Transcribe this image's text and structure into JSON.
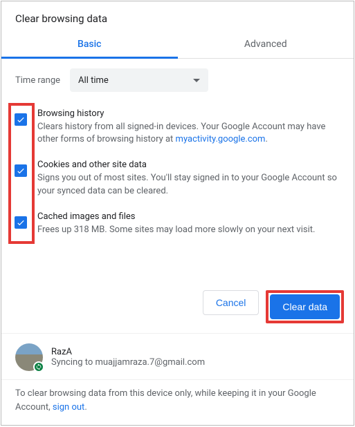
{
  "dialog": {
    "title": "Clear browsing data"
  },
  "tabs": {
    "basic": "Basic",
    "advanced": "Advanced"
  },
  "time_range": {
    "label": "Time range",
    "value": "All time"
  },
  "options": {
    "browsing": {
      "title": "Browsing history",
      "desc_pre": "Clears history from all signed-in devices. Your Google Account may have other forms of browsing history at ",
      "desc_link": "myactivity.google.com",
      "desc_post": ".",
      "checked": true
    },
    "cookies": {
      "title": "Cookies and other site data",
      "desc": "Signs you out of most sites. You'll stay signed in to your Google Account so your synced data can be cleared.",
      "checked": true
    },
    "cache": {
      "title": "Cached images and files",
      "desc": "Frees up 318 MB. Some sites may load more slowly on your next visit.",
      "checked": true
    }
  },
  "buttons": {
    "cancel": "Cancel",
    "clear": "Clear data"
  },
  "account": {
    "name": "RazA",
    "sync_pre": "Syncing to ",
    "sync_email": "muajjamraza.7@gmail.com"
  },
  "footer": {
    "text_pre": "To clear browsing data from this device only, while keeping it in your Google Account, ",
    "link": "sign out",
    "text_post": "."
  }
}
